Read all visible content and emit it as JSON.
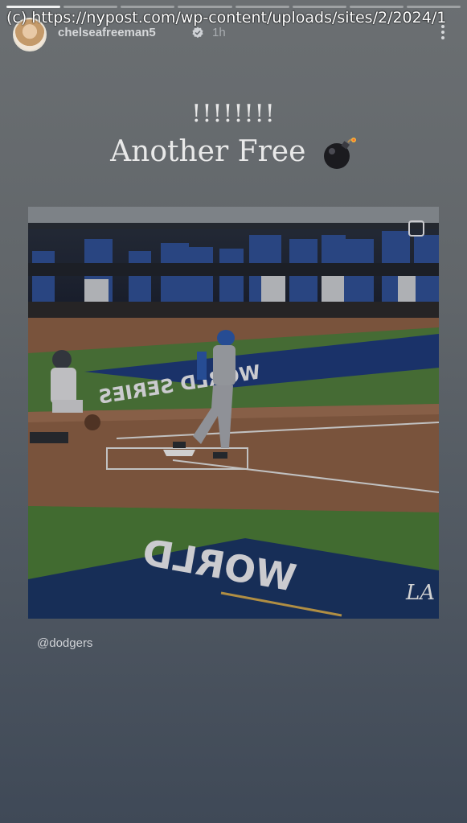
{
  "watermark": "(c) https://nypost.com/wp-content/uploads/sites/2/2024/1",
  "story": {
    "segments": 8,
    "active_segment": 1
  },
  "header": {
    "username": "chelseafreeman5",
    "time": "1h",
    "verified_icon": "verified-badge-icon",
    "more_icon": "more-vertical-icon"
  },
  "caption": {
    "exclamations": "!!!!!!!!",
    "text": "Another Free",
    "emoji": "bomb-icon"
  },
  "photo": {
    "logo": "LA",
    "field_text_top": "WORLD SERIES",
    "field_text_bottom": "WORLD"
  },
  "mention": "@dodgers",
  "colors": {
    "background_top": "#6b6f72",
    "background_bottom": "#3f4957",
    "dodger_blue": "#1e3a78",
    "grass": "#4f7a3c",
    "dirt": "#8a5f45"
  }
}
